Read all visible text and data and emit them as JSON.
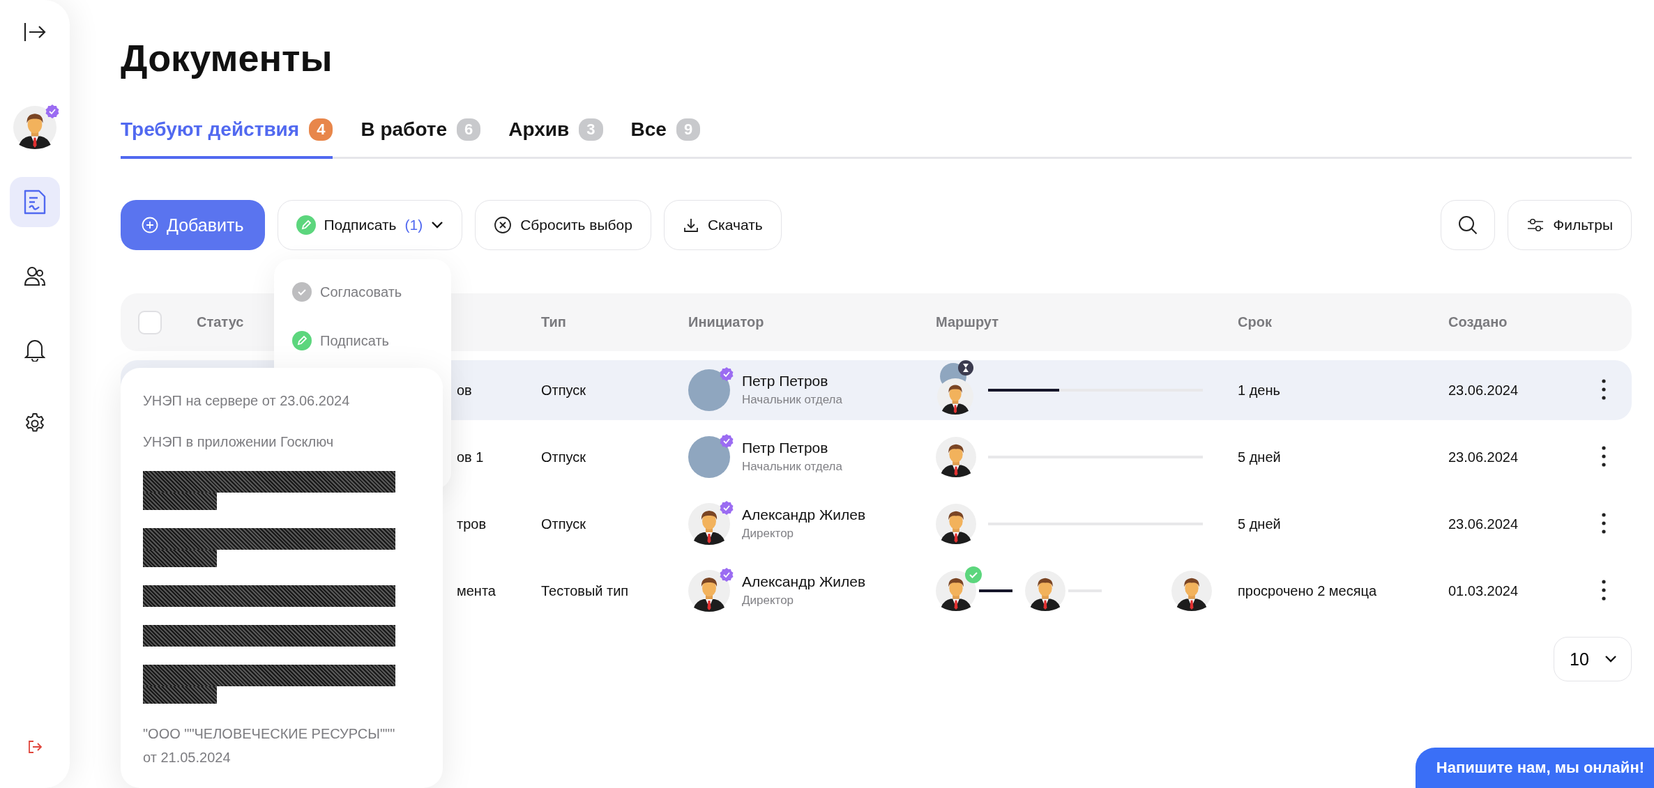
{
  "sidebar": {
    "nav": [
      {
        "kind": "documents",
        "selected": true
      },
      {
        "kind": "users",
        "selected": false
      },
      {
        "kind": "notifications",
        "selected": false
      },
      {
        "kind": "settings",
        "selected": false
      }
    ]
  },
  "title": "Документы",
  "tabs": [
    {
      "label": "Требуют действия",
      "count": "4",
      "selected": true
    },
    {
      "label": "В работе",
      "count": "6",
      "selected": false
    },
    {
      "label": "Архив",
      "count": "3",
      "selected": false
    },
    {
      "label": "Все",
      "count": "9",
      "selected": false
    }
  ],
  "toolbar": {
    "add_button": "Добавить",
    "sign_button": {
      "label": "Подписать",
      "count": "(1)",
      "expanded": true
    },
    "reset_button": "Сбросить выбор",
    "download_button": "Скачать",
    "filters_button": "Фильтры"
  },
  "sign_menu": [
    {
      "kind": "approve",
      "label": "Согласовать"
    },
    {
      "kind": "sign",
      "label": "Подписать"
    }
  ],
  "sign_methods": [
    {
      "kind": "text",
      "label": "УНЭП на сервере от 23.06.2024"
    },
    {
      "kind": "text",
      "label": "УНЭП в приложении Госключ"
    },
    {
      "kind": "redacted",
      "wrap": true
    },
    {
      "kind": "redacted",
      "wrap": true
    },
    {
      "kind": "redacted",
      "wrap": false
    },
    {
      "kind": "redacted",
      "wrap": false
    },
    {
      "kind": "redacted",
      "wrap": true
    },
    {
      "kind": "text",
      "label": "\"ООО \"\"ЧЕЛОВЕЧЕСКИЕ РЕСУРСЫ\"\"\" от 21.05.2024"
    }
  ],
  "table": {
    "select_all": {
      "checked": false
    },
    "columns": [
      "Статус",
      "Тип",
      "Инициатор",
      "Маршрут",
      "Срок",
      "Создано"
    ],
    "rows": [
      {
        "name": "ов",
        "type": "Отпуск",
        "initiator": {
          "name": "Петр Петров",
          "role": "Начальник отдела",
          "avatar": {
            "kind": "photo"
          }
        },
        "route": {
          "kind": "bar",
          "pending": true,
          "level": 0.33
        },
        "term": "1 день",
        "created": "23.06.2024",
        "selected": true
      },
      {
        "name": "ов 1",
        "type": "Отпуск",
        "initiator": {
          "name": "Петр Петров",
          "role": "Начальник отдела",
          "avatar": {
            "kind": "photo"
          }
        },
        "route": {
          "kind": "bar",
          "pending": false,
          "level": 0
        },
        "term": "5 дней",
        "created": "23.06.2024",
        "selected": false
      },
      {
        "name": "тров",
        "type": "Отпуск",
        "initiator": {
          "name": "Александр Жилев",
          "role": "Директор",
          "avatar": {
            "kind": "silhouette"
          }
        },
        "route": {
          "kind": "bar",
          "pending": false,
          "level": 0
        },
        "term": "5 дней",
        "created": "23.06.2024",
        "selected": false
      },
      {
        "name": "мента",
        "type": "Тестовый тип",
        "initiator": {
          "name": "Александр Жилев",
          "role": "Директор",
          "avatar": {
            "kind": "silhouette"
          }
        },
        "route": {
          "kind": "steps",
          "steps": [
            {
              "approved": true
            },
            {
              "approved": false
            },
            {
              "approved": false
            }
          ]
        },
        "term": "просрочено 2 месяца",
        "created": "01.03.2024",
        "selected": false
      }
    ]
  },
  "page_size": "10",
  "chat_button": "Напишите нам, мы онлайн!"
}
